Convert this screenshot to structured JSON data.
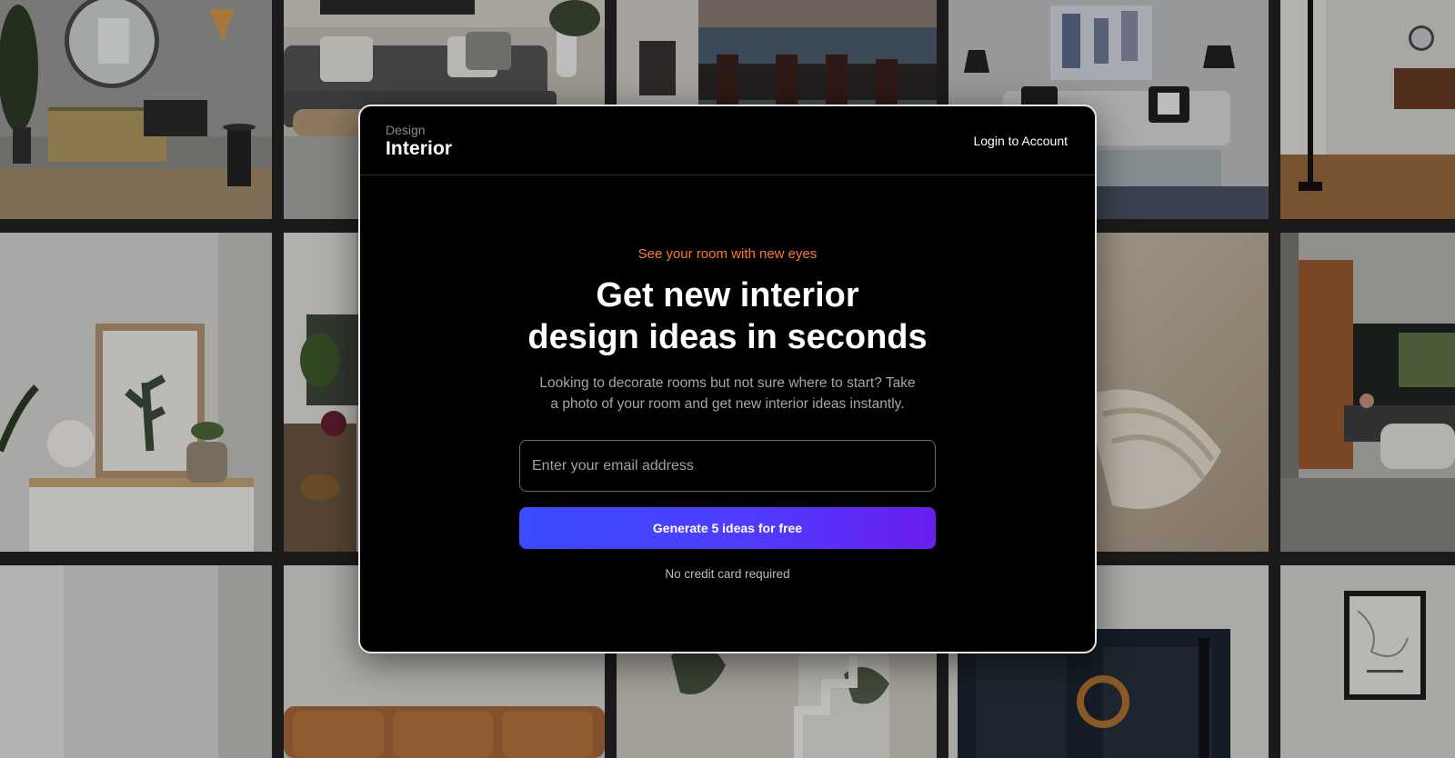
{
  "brand": {
    "top": "Design",
    "main": "Interior"
  },
  "header": {
    "login_label": "Login to Account"
  },
  "hero": {
    "eyebrow": "See your room with new eyes",
    "headline_line1": "Get new interior",
    "headline_line2": "design ideas in seconds",
    "description_line1": "Looking to decorate rooms but not sure where to start? Take",
    "description_line2": "a photo of your room and get new interior ideas instantly."
  },
  "form": {
    "email_placeholder": "Enter your email address",
    "email_value": "",
    "submit_label": "Generate 5 ideas for free",
    "note": "No credit card required"
  },
  "colors": {
    "accent_orange": "#ff7a2f",
    "button_gradient_start": "#3b4cff",
    "button_gradient_end": "#6b1dee",
    "modal_background": "#000000"
  },
  "background_photos": [
    "living-room-mirror-sideboard-photo",
    "grey-sofa-living-room-photo",
    "dining-room-sea-view-photo",
    "white-sofa-abstract-art-photo",
    "wood-floor-hallway-photo",
    "white-console-plant-frame-photo",
    "plants-living-room-photo",
    "blurred-fabric-closeup-photo",
    "wood-wall-lounge-photo",
    "white-wall-room-photo",
    "leather-sofa-photo",
    "staircase-plant-photo",
    "dark-doors-wreath-photo",
    "framed-map-wall-photo"
  ]
}
